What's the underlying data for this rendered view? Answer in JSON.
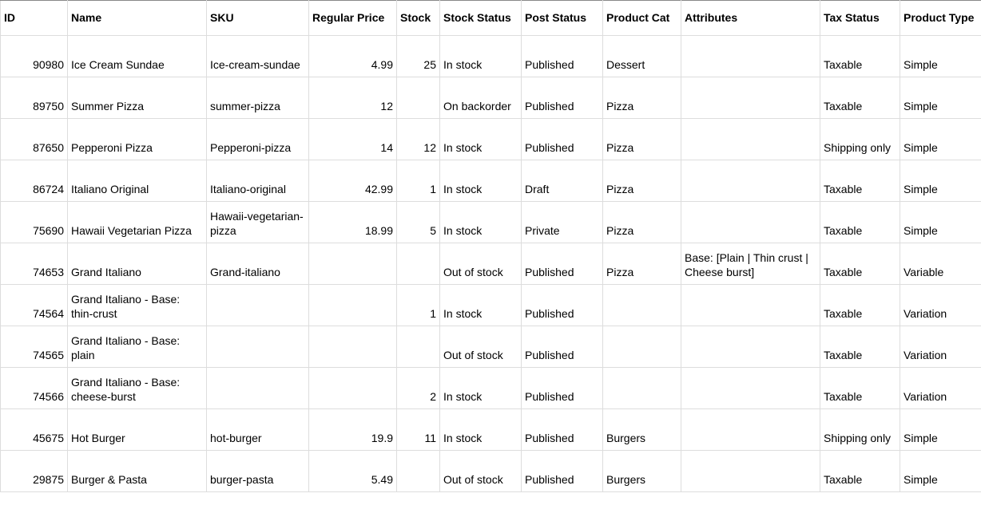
{
  "columns": [
    {
      "key": "id",
      "label": "ID",
      "align": "num"
    },
    {
      "key": "name",
      "label": "Name",
      "align": "txt"
    },
    {
      "key": "sku",
      "label": "SKU",
      "align": "txt"
    },
    {
      "key": "regular_price",
      "label": "Regular Price",
      "align": "num"
    },
    {
      "key": "stock",
      "label": "Stock",
      "align": "num"
    },
    {
      "key": "stock_status",
      "label": "Stock Status",
      "align": "txt"
    },
    {
      "key": "post_status",
      "label": "Post Status",
      "align": "txt"
    },
    {
      "key": "product_cat",
      "label": "Product Cat",
      "align": "txt"
    },
    {
      "key": "attributes",
      "label": "Attributes",
      "align": "txt"
    },
    {
      "key": "tax_status",
      "label": "Tax Status",
      "align": "txt"
    },
    {
      "key": "product_type",
      "label": "Product Type",
      "align": "txt"
    }
  ],
  "rows": [
    {
      "id": "90980",
      "name": "Ice Cream Sundae",
      "sku": "Ice-cream-sundae",
      "regular_price": "4.99",
      "stock": "25",
      "stock_status": "In stock",
      "post_status": "Published",
      "product_cat": "Dessert",
      "attributes": "",
      "tax_status": "Taxable",
      "product_type": "Simple"
    },
    {
      "id": "89750",
      "name": "Summer Pizza",
      "sku": "summer-pizza",
      "regular_price": "12",
      "stock": "",
      "stock_status": "On backorder",
      "post_status": "Published",
      "product_cat": "Pizza",
      "attributes": "",
      "tax_status": "Taxable",
      "product_type": "Simple"
    },
    {
      "id": "87650",
      "name": "Pepperoni Pizza",
      "sku": "Pepperoni-pizza",
      "regular_price": "14",
      "stock": "12",
      "stock_status": "In stock",
      "post_status": "Published",
      "product_cat": "Pizza",
      "attributes": "",
      "tax_status": "Shipping only",
      "product_type": "Simple"
    },
    {
      "id": "86724",
      "name": "Italiano Original",
      "sku": "Italiano-original",
      "regular_price": "42.99",
      "stock": "1",
      "stock_status": "In stock",
      "post_status": "Draft",
      "product_cat": "Pizza",
      "attributes": "",
      "tax_status": "Taxable",
      "product_type": "Simple"
    },
    {
      "id": "75690",
      "name": "Hawaii Vegetarian Pizza",
      "sku": "Hawaii-vegetarian-pizza",
      "regular_price": "18.99",
      "stock": "5",
      "stock_status": "In stock",
      "post_status": "Private",
      "product_cat": "Pizza",
      "attributes": "",
      "tax_status": "Taxable",
      "product_type": "Simple"
    },
    {
      "id": "74653",
      "name": "Grand Italiano",
      "sku": "Grand-italiano",
      "regular_price": "",
      "stock": "",
      "stock_status": "Out of stock",
      "post_status": "Published",
      "product_cat": "Pizza",
      "attributes": "Base: [Plain | Thin crust | Cheese burst]",
      "tax_status": "Taxable",
      "product_type": "Variable"
    },
    {
      "id": "74564",
      "name": "Grand Italiano - Base: thin-crust",
      "sku": "",
      "regular_price": "",
      "stock": "1",
      "stock_status": "In stock",
      "post_status": "Published",
      "product_cat": "",
      "attributes": "",
      "tax_status": "Taxable",
      "product_type": "Variation"
    },
    {
      "id": "74565",
      "name": "Grand Italiano - Base: plain",
      "sku": "",
      "regular_price": "",
      "stock": "",
      "stock_status": "Out of stock",
      "post_status": "Published",
      "product_cat": "",
      "attributes": "",
      "tax_status": "Taxable",
      "product_type": "Variation"
    },
    {
      "id": "74566",
      "name": "Grand Italiano - Base: cheese-burst",
      "sku": "",
      "regular_price": "",
      "stock": "2",
      "stock_status": "In stock",
      "post_status": "Published",
      "product_cat": "",
      "attributes": "",
      "tax_status": "Taxable",
      "product_type": "Variation"
    },
    {
      "id": "45675",
      "name": "Hot Burger",
      "sku": "hot-burger",
      "regular_price": "19.9",
      "stock": "11",
      "stock_status": "In stock",
      "post_status": "Published",
      "product_cat": "Burgers",
      "attributes": "",
      "tax_status": "Shipping only",
      "product_type": "Simple"
    },
    {
      "id": "29875",
      "name": "Burger & Pasta",
      "sku": "burger-pasta",
      "regular_price": "5.49",
      "stock": "",
      "stock_status": "Out of stock",
      "post_status": "Published",
      "product_cat": "Burgers",
      "attributes": "",
      "tax_status": "Taxable",
      "product_type": "Simple"
    }
  ]
}
